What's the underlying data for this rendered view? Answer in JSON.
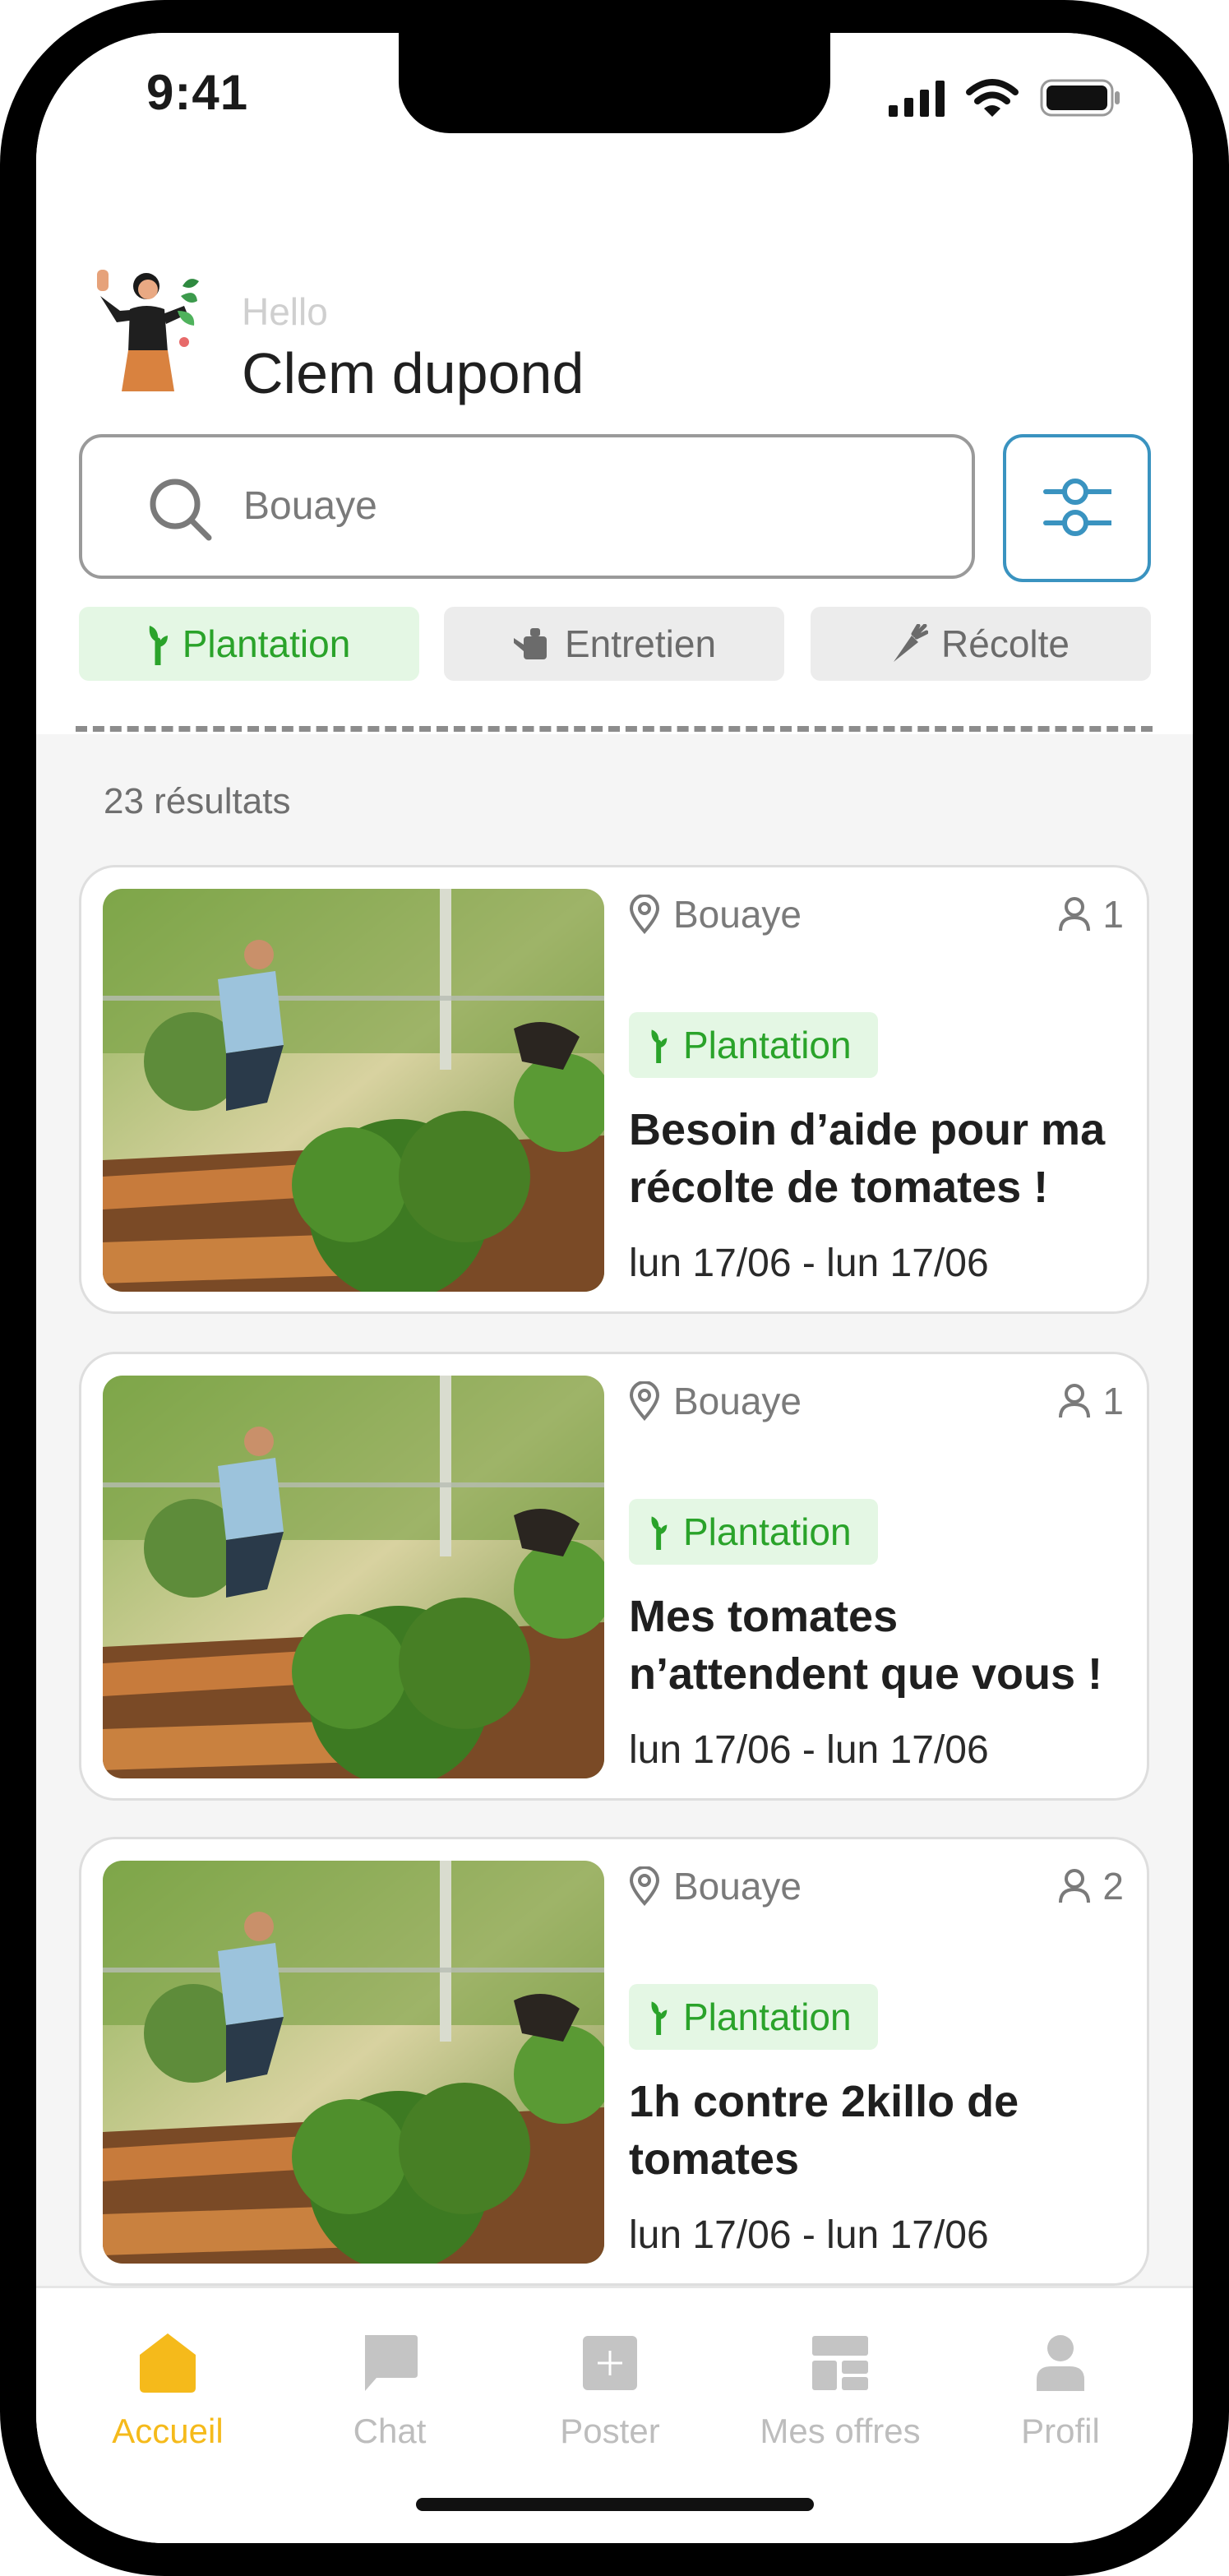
{
  "status_bar": {
    "time": "9:41"
  },
  "header": {
    "hello": "Hello",
    "name": "Clem dupond"
  },
  "search": {
    "value": "Bouaye"
  },
  "categories": [
    {
      "label": "Plantation",
      "icon": "sprout-icon",
      "active": true
    },
    {
      "label": "Entretien",
      "icon": "watering-can-icon",
      "active": false
    },
    {
      "label": "Récolte",
      "icon": "carrot-icon",
      "active": false
    }
  ],
  "results_count": "23 résultats",
  "cards": [
    {
      "location": "Bouaye",
      "count": "1",
      "tag": "Plantation",
      "title": "Besoin d’aide pour ma récolte de tomates !",
      "date": "lun 17/06 - lun 17/06"
    },
    {
      "location": "Bouaye",
      "count": "1",
      "tag": "Plantation",
      "title": "Mes tomates n’attendent que vous !",
      "date": "lun 17/06 - lun 17/06"
    },
    {
      "location": "Bouaye",
      "count": "2",
      "tag": "Plantation",
      "title": "1h contre 2killo de tomates",
      "date": "lun 17/06 - lun 17/06"
    }
  ],
  "tabbar": [
    {
      "label": "Accueil",
      "icon": "home-icon",
      "active": true
    },
    {
      "label": "Chat",
      "icon": "chat-icon",
      "active": false
    },
    {
      "label": "Poster",
      "icon": "plus-square-icon",
      "active": false
    },
    {
      "label": "Mes offres",
      "icon": "dashboard-icon",
      "active": false
    },
    {
      "label": "Profil",
      "icon": "user-icon",
      "active": false
    }
  ],
  "colors": {
    "accent": "#f5ba1b",
    "green": "#2aa32a",
    "green_bg": "#e4f7e4",
    "blue": "#3a93c0"
  }
}
